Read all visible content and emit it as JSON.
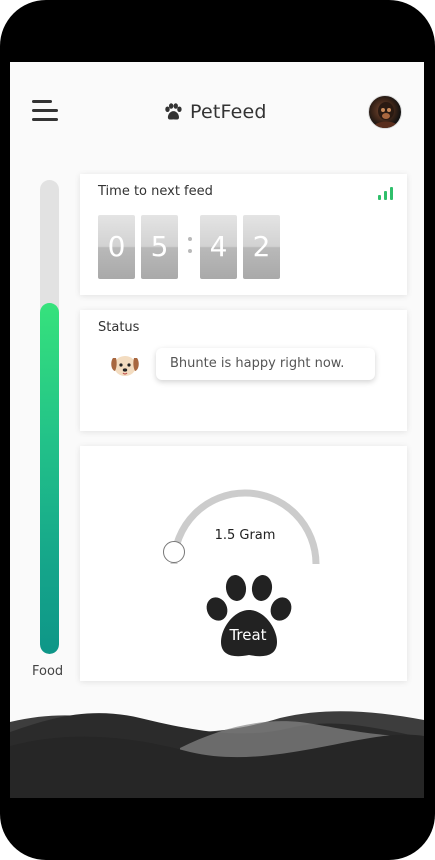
{
  "app": {
    "name": "PetFeed"
  },
  "colors": {
    "accent": "#2fbf6b",
    "food_top": "#36e27c",
    "food_bottom": "#0e9688",
    "dark": "#222222"
  },
  "icons": {
    "menu": "hamburger-menu-icon",
    "brand": "paw-icon",
    "signal": "signal-bars-icon",
    "pet": "dog-face-icon",
    "treat": "paw-print-icon"
  },
  "food": {
    "label": "Food",
    "level": 0.74
  },
  "feed_timer": {
    "title": "Time to next feed",
    "digits": [
      "0",
      "5",
      "4",
      "2"
    ]
  },
  "status": {
    "title": "Status",
    "message": "Bhunte is happy right now."
  },
  "treat": {
    "amount": "1.5 Gram",
    "button_label": "Treat"
  }
}
